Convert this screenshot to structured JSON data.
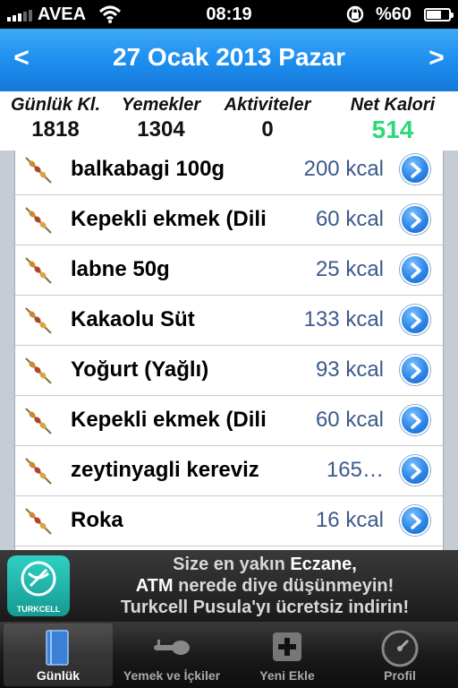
{
  "status": {
    "carrier": "AVEA",
    "time": "08:19",
    "battery": "%60"
  },
  "header": {
    "title": "27 Ocak 2013 Pazar",
    "prev": "<",
    "next": ">"
  },
  "summary": {
    "cols": [
      {
        "label": "Günlük Kl.",
        "value": "1818"
      },
      {
        "label": "Yemekler",
        "value": "1304"
      },
      {
        "label": "Aktiviteler",
        "value": "0"
      },
      {
        "label": "Net Kalori",
        "value": "514"
      }
    ],
    "net_color": "#2fd87a"
  },
  "items": [
    {
      "name": "balkabagi 100g",
      "kcal": "200 kcal",
      "icon": "skewer-icon"
    },
    {
      "name": "Kepekli ekmek (Dili",
      "kcal": "60 kcal",
      "icon": "skewer-icon"
    },
    {
      "name": "labne 50g",
      "kcal": "25 kcal",
      "icon": "skewer-icon"
    },
    {
      "name": "Kakaolu Süt",
      "kcal": "133 kcal",
      "icon": "skewer-icon"
    },
    {
      "name": "Yoğurt (Yağlı)",
      "kcal": "93 kcal",
      "icon": "skewer-icon"
    },
    {
      "name": "Kepekli ekmek (Dili",
      "kcal": "60 kcal",
      "icon": "skewer-icon"
    },
    {
      "name": "zeytinyagli kereviz",
      "kcal": "165…",
      "icon": "skewer-icon"
    },
    {
      "name": "Roka",
      "kcal": "16 kcal",
      "icon": "skewer-icon"
    }
  ],
  "ad": {
    "brand": "TURKCELL",
    "line1_a": "Size en yakın ",
    "line1_b": "Eczane,",
    "line2_a": "ATM",
    "line2_b": " nerede diye düşünmeyin!",
    "line3": "Turkcell Pusula'yı ücretsiz indirin!"
  },
  "tabs": [
    {
      "label": "Günlük",
      "icon": "book-icon"
    },
    {
      "label": "Yemek ve İçkiler",
      "icon": "food-icon"
    },
    {
      "label": "Yeni Ekle",
      "icon": "plus-icon"
    },
    {
      "label": "Profil",
      "icon": "gauge-icon"
    }
  ],
  "colors": {
    "accent": "#1e8ff0",
    "kcal": "#3b5a8a",
    "net": "#2fd87a"
  }
}
